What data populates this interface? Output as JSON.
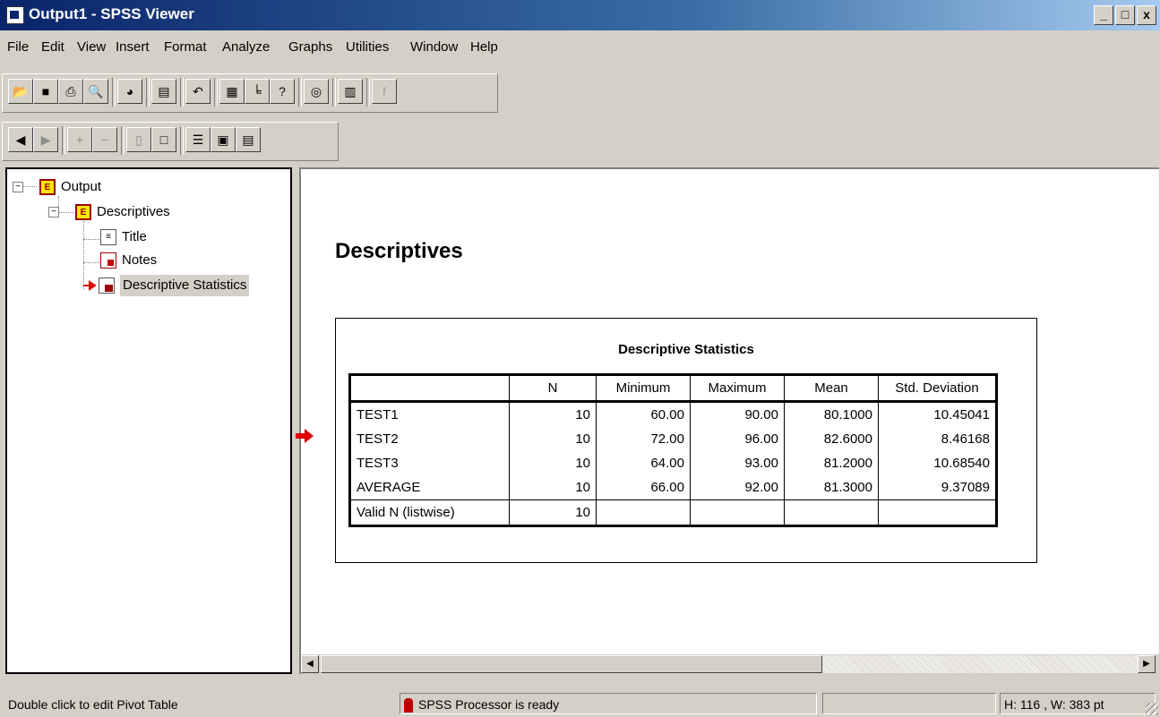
{
  "window": {
    "title": "Output1 - SPSS Viewer",
    "controls": [
      "_",
      "□",
      "x"
    ]
  },
  "menu": [
    {
      "label": "File"
    },
    {
      "label": "Edit"
    },
    {
      "label": "View"
    },
    {
      "label": "Insert"
    },
    {
      "label": "Format"
    },
    {
      "label": "Analyze"
    },
    {
      "label": "Graphs"
    },
    {
      "label": "Utilities"
    },
    {
      "label": "Window"
    },
    {
      "label": "Help"
    }
  ],
  "toolbar1": [
    "open-icon",
    "save-icon",
    "print-icon",
    "print-preview-icon",
    "export-icon",
    "dialog-recall-icon",
    "undo-icon",
    "goto-data-icon",
    "goto-chart-icon",
    "variables-icon",
    "use-sets-icon",
    "designate-window-icon",
    "run-current-icon"
  ],
  "toolbar2": [
    "promote-icon",
    "demote-icon",
    "expand-icon",
    "collapse-icon",
    "show-icon",
    "hide-icon",
    "insert-heading-icon",
    "insert-title-icon",
    "insert-text-icon"
  ],
  "outline": {
    "root": "Output",
    "section": "Descriptives",
    "items": [
      "Title",
      "Notes",
      "Descriptive Statistics"
    ]
  },
  "content": {
    "heading": "Descriptives",
    "table": {
      "title": "Descriptive Statistics",
      "columns": [
        "",
        "N",
        "Minimum",
        "Maximum",
        "Mean",
        "Std. Deviation"
      ],
      "rows": [
        [
          "TEST1",
          "10",
          "60.00",
          "90.00",
          "80.1000",
          "10.45041"
        ],
        [
          "TEST2",
          "10",
          "72.00",
          "96.00",
          "82.6000",
          "8.46168"
        ],
        [
          "TEST3",
          "10",
          "64.00",
          "93.00",
          "81.2000",
          "10.68540"
        ],
        [
          "AVERAGE",
          "10",
          "66.00",
          "92.00",
          "81.3000",
          "9.37089"
        ]
      ],
      "last_row": [
        "Valid N (listwise)",
        "10",
        "",
        "",
        "",
        ""
      ]
    }
  },
  "status": {
    "hint": "Double click to edit Pivot Table",
    "processor": "SPSS Processor  is ready",
    "size": "H: 116 , W: 383 pt"
  }
}
